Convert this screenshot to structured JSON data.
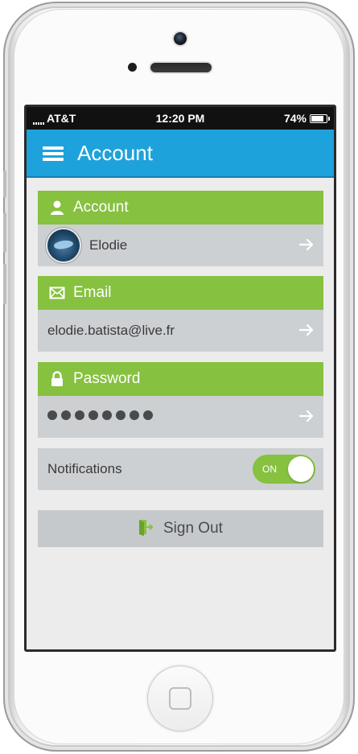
{
  "status_bar": {
    "carrier": "AT&T",
    "time": "12:20 PM",
    "battery": "74%",
    "battery_level": 0.74
  },
  "nav": {
    "title": "Account",
    "menu_icon": "hamburger-menu-icon"
  },
  "account": {
    "header": "Account",
    "header_icon": "user-icon",
    "user_name": "Elodie"
  },
  "email": {
    "header": "Email",
    "header_icon": "envelope-icon",
    "value": "elodie.batista@live.fr"
  },
  "password": {
    "header": "Password",
    "header_icon": "lock-icon",
    "masked_length": 8
  },
  "notifications": {
    "label": "Notifications",
    "toggle_state": "ON",
    "enabled": true
  },
  "sign_out": {
    "label": "Sign Out",
    "icon": "sign-out-icon"
  },
  "colors": {
    "nav_blue": "#1ea2dc",
    "section_green": "#86c13f",
    "row_gray": "#cdd0d3",
    "background": "#ececec"
  }
}
